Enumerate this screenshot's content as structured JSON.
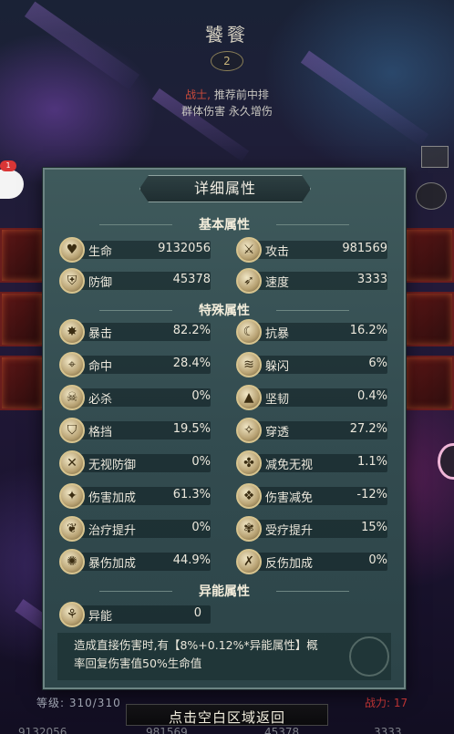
{
  "hero": {
    "name": "饕餮",
    "emblem": "2",
    "class": "战士,",
    "desc_line1": "推荐前中排",
    "desc_line2": "群体伤害 永久增伤"
  },
  "chat": {
    "badge": "1"
  },
  "dialog": {
    "title": "详细属性",
    "basic_title": "基本属性",
    "special_title": "特殊属性",
    "abnormal_title": "异能属性",
    "basic": [
      {
        "icon": "heart-icon",
        "glyph": "♥",
        "name": "生命",
        "value": "9132056"
      },
      {
        "icon": "sword-icon",
        "glyph": "⚔",
        "name": "攻击",
        "value": "981569"
      },
      {
        "icon": "shield-icon",
        "glyph": "⛨",
        "name": "防御",
        "value": "45378"
      },
      {
        "icon": "boot-icon",
        "glyph": "➶",
        "name": "速度",
        "value": "3333"
      }
    ],
    "special_left": [
      {
        "icon": "crit-icon",
        "glyph": "✸",
        "name": "暴击",
        "value": "82.2%"
      },
      {
        "icon": "hit-icon",
        "glyph": "⌖",
        "name": "命中",
        "value": "28.4%"
      },
      {
        "icon": "kill-icon",
        "glyph": "☠",
        "name": "必杀",
        "value": "0%"
      },
      {
        "icon": "block-icon",
        "glyph": "⛉",
        "name": "格挡",
        "value": "19.5%"
      },
      {
        "icon": "ignore-def-icon",
        "glyph": "✕",
        "name": "无视防御",
        "value": "0%"
      },
      {
        "icon": "dmg-bonus-icon",
        "glyph": "✦",
        "name": "伤害加成",
        "value": "61.3%"
      },
      {
        "icon": "heal-icon",
        "glyph": "❦",
        "name": "治疗提升",
        "value": "0%"
      },
      {
        "icon": "crit-dmg-icon",
        "glyph": "✺",
        "name": "暴伤加成",
        "value": "44.9%"
      }
    ],
    "special_right": [
      {
        "icon": "anti-crit-icon",
        "glyph": "☾",
        "name": "抗暴",
        "value": "16.2%"
      },
      {
        "icon": "dodge-icon",
        "glyph": "≋",
        "name": "躲闪",
        "value": "6%"
      },
      {
        "icon": "toughness-icon",
        "glyph": "▲",
        "name": "坚韧",
        "value": "0.4%"
      },
      {
        "icon": "pierce-icon",
        "glyph": "✧",
        "name": "穿透",
        "value": "27.2%"
      },
      {
        "icon": "immune-ignore-icon",
        "glyph": "✤",
        "name": "减免无视",
        "value": "1.1%"
      },
      {
        "icon": "dmg-reduce-icon",
        "glyph": "❖",
        "name": "伤害减免",
        "value": "-12%"
      },
      {
        "icon": "heal-received-icon",
        "glyph": "✾",
        "name": "受疗提升",
        "value": "15%"
      },
      {
        "icon": "reflect-icon",
        "glyph": "✗",
        "name": "反伤加成",
        "value": "0%"
      }
    ],
    "abnormal": {
      "icon": "abnormal-icon",
      "glyph": "⚘",
      "name": "异能",
      "value": "0"
    },
    "desc_line1": "造成直接伤害时,有【8%+0.12%*异能属性】概",
    "desc_line2": "率回复伤害值50%生命值"
  },
  "bottom": {
    "level_label": "等级: 310/310",
    "right_label": "战力: 17",
    "return_label": "点击空白区域返回",
    "values": [
      "9132056",
      "981569",
      "45378",
      "3333"
    ]
  },
  "colors": {
    "panel": "#3f5a5c",
    "panel_border": "#6c8483",
    "icon_gold": "#d7c48f",
    "class_red": "#c94a3a"
  }
}
